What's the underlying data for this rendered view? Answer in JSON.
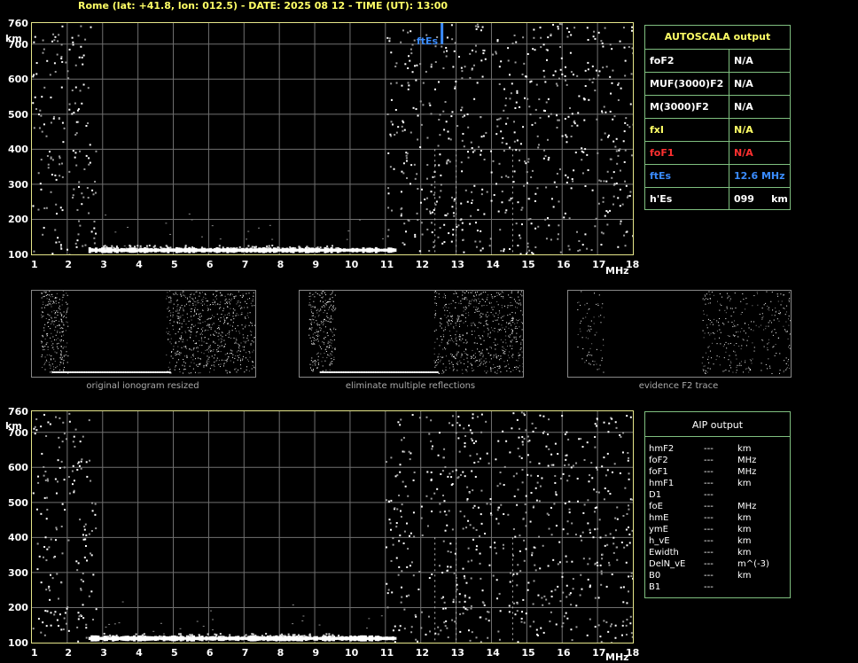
{
  "header": "Rome (lat: +41.8, lon: 012.5) - DATE: 2025 08 12 - TIME (UT): 13:00",
  "km_label": "km",
  "mhz_label": "MHz",
  "ftes_marker_label": "ftEs",
  "colors": {
    "border": "#e6e68a",
    "grid": "#707070",
    "trace": "#ffffff",
    "yellow": "#ffff66",
    "red": "#ff3030",
    "blue": "#3a8cff",
    "green_border": "#7fbf7f"
  },
  "autoscala": {
    "title": "AUTOSCALA output",
    "rows": [
      {
        "key": "foF2",
        "value": "N/A",
        "color": "#ffffff"
      },
      {
        "key": "MUF(3000)F2",
        "value": "N/A",
        "color": "#ffffff"
      },
      {
        "key": "M(3000)F2",
        "value": "N/A",
        "color": "#ffffff"
      },
      {
        "key": "fxI",
        "value": "N/A",
        "color": "#ffff66"
      },
      {
        "key": "foF1",
        "value": "N/A",
        "color": "#ff3030"
      },
      {
        "key": "ftEs",
        "value": "12.6 MHz",
        "color": "#3a8cff"
      },
      {
        "key": "h'Es",
        "value": "099     km",
        "color": "#ffffff"
      }
    ]
  },
  "aip": {
    "title": "AIP output",
    "rows": [
      {
        "key": "hmF2",
        "value": "---",
        "unit": "km"
      },
      {
        "key": "foF2",
        "value": "---",
        "unit": "MHz"
      },
      {
        "key": "foF1",
        "value": "---",
        "unit": "MHz"
      },
      {
        "key": "hmF1",
        "value": "---",
        "unit": "km"
      },
      {
        "key": "D1",
        "value": "---",
        "unit": ""
      },
      {
        "key": "foE",
        "value": "---",
        "unit": "MHz"
      },
      {
        "key": "hmE",
        "value": "---",
        "unit": "km"
      },
      {
        "key": "ymE",
        "value": "---",
        "unit": "km"
      },
      {
        "key": "h_vE",
        "value": "---",
        "unit": "km"
      },
      {
        "key": "Ewidth",
        "value": "---",
        "unit": "km"
      },
      {
        "key": "DelN_vE",
        "value": "---",
        "unit": "m^(-3)"
      },
      {
        "key": "B0",
        "value": "---",
        "unit": "km"
      },
      {
        "key": "B1",
        "value": "---",
        "unit": ""
      }
    ]
  },
  "captions": [
    "original ionogram resized",
    "eliminate multiple reflections",
    "evidence F2 trace"
  ],
  "chart_data": [
    {
      "type": "scatter",
      "xlabel": "MHz",
      "ylabel": "km",
      "xlim": [
        1,
        18
      ],
      "ylim": [
        100,
        760
      ],
      "x_ticks": [
        1,
        2,
        3,
        4,
        5,
        6,
        7,
        8,
        9,
        10,
        11,
        12,
        13,
        14,
        15,
        16,
        17,
        18
      ],
      "y_ticks": [
        100,
        200,
        300,
        400,
        500,
        600,
        700,
        760
      ],
      "grid": true,
      "trace_band": {
        "x_start": 2.6,
        "x_end": 11.3,
        "height_km": 112
      },
      "ftes_mhz": 12.6,
      "noise_regions_mhz": [
        [
          1,
          2.8
        ],
        [
          11.0,
          18
        ]
      ]
    },
    {
      "type": "scatter",
      "xlabel": "MHz",
      "ylabel": "km",
      "xlim": [
        1,
        18
      ],
      "ylim": [
        100,
        760
      ],
      "x_ticks": [
        1,
        2,
        3,
        4,
        5,
        6,
        7,
        8,
        9,
        10,
        11,
        12,
        13,
        14,
        15,
        16,
        17,
        18
      ],
      "y_ticks": [
        100,
        200,
        300,
        400,
        500,
        600,
        700,
        760
      ],
      "grid": true,
      "trace_band": {
        "x_start": 2.6,
        "x_end": 11.3,
        "height_km": 112
      },
      "noise_regions_mhz": [
        [
          1,
          2.8
        ],
        [
          11.0,
          18
        ]
      ]
    }
  ]
}
